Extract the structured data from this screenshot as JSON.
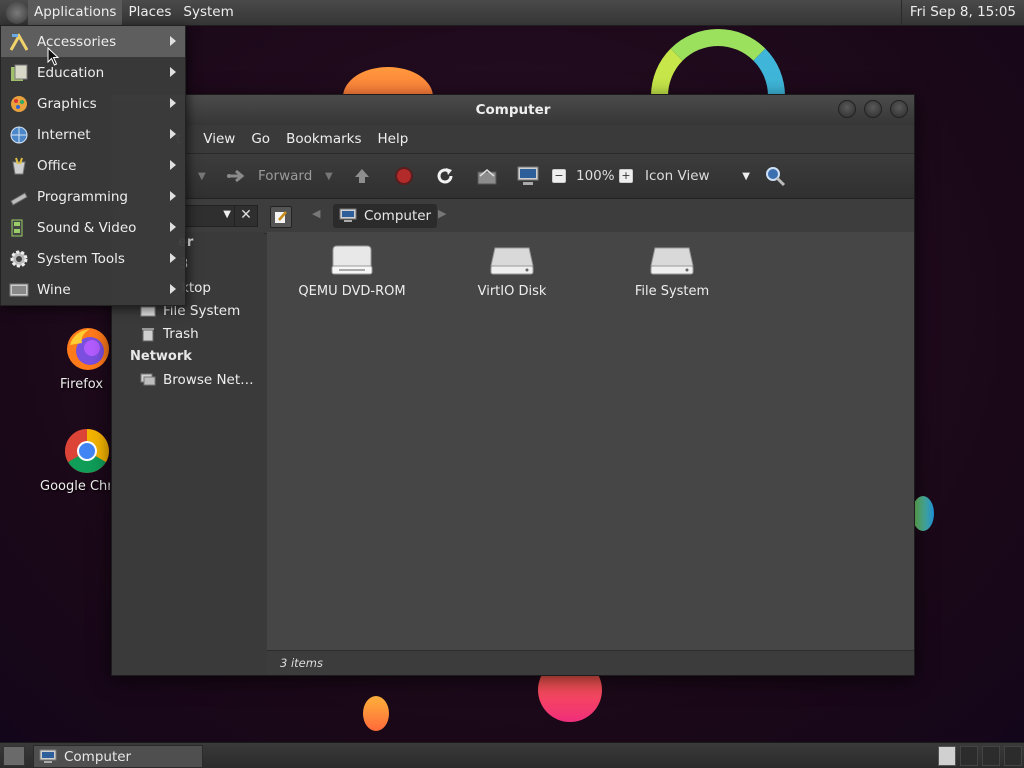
{
  "top_panel": {
    "menus": [
      "Applications",
      "Places",
      "System"
    ],
    "clock": "Fri Sep  8, 15:05"
  },
  "app_menu": {
    "items": [
      {
        "label": "Accessories",
        "icon": "accessories-icon"
      },
      {
        "label": "Education",
        "icon": "education-icon"
      },
      {
        "label": "Graphics",
        "icon": "graphics-icon"
      },
      {
        "label": "Internet",
        "icon": "internet-icon"
      },
      {
        "label": "Office",
        "icon": "office-icon"
      },
      {
        "label": "Programming",
        "icon": "programming-icon"
      },
      {
        "label": "Sound & Video",
        "icon": "sound-video-icon"
      },
      {
        "label": "System Tools",
        "icon": "system-tools-icon"
      },
      {
        "label": "Wine",
        "icon": "wine-icon"
      }
    ]
  },
  "desktop_icons": {
    "firefox": "Firefox",
    "chrome": "Google Chr"
  },
  "window": {
    "title": "Computer",
    "menu": [
      "t",
      "View",
      "Go",
      "Bookmarks",
      "Help"
    ],
    "toolbar": {
      "forward": "Forward",
      "zoom": "100%",
      "view_mode": "Icon View"
    },
    "location": {
      "crumb": "Computer"
    },
    "sidebar": {
      "partial_header": "er",
      "partial_item": "3",
      "items": [
        {
          "label": "ktop",
          "icon": "desktop-icon"
        },
        {
          "label": "File System",
          "icon": "drive-icon"
        },
        {
          "label": "Trash",
          "icon": "trash-icon"
        }
      ],
      "network_header": "Network",
      "network_items": [
        {
          "label": "Browse Net…",
          "icon": "network-icon"
        }
      ]
    },
    "drives": [
      {
        "label": "QEMU DVD-ROM",
        "icon": "optical-drive-icon"
      },
      {
        "label": "VirtIO Disk",
        "icon": "hard-disk-icon"
      },
      {
        "label": "File System",
        "icon": "hard-disk-icon"
      }
    ],
    "status": "3 items"
  },
  "taskbar": {
    "task": "Computer"
  },
  "colors": {
    "panel": "#3d3d3d",
    "window_bg": "#3a3a3a",
    "content_bg": "#464646",
    "desktop": "#1b0a1a"
  }
}
